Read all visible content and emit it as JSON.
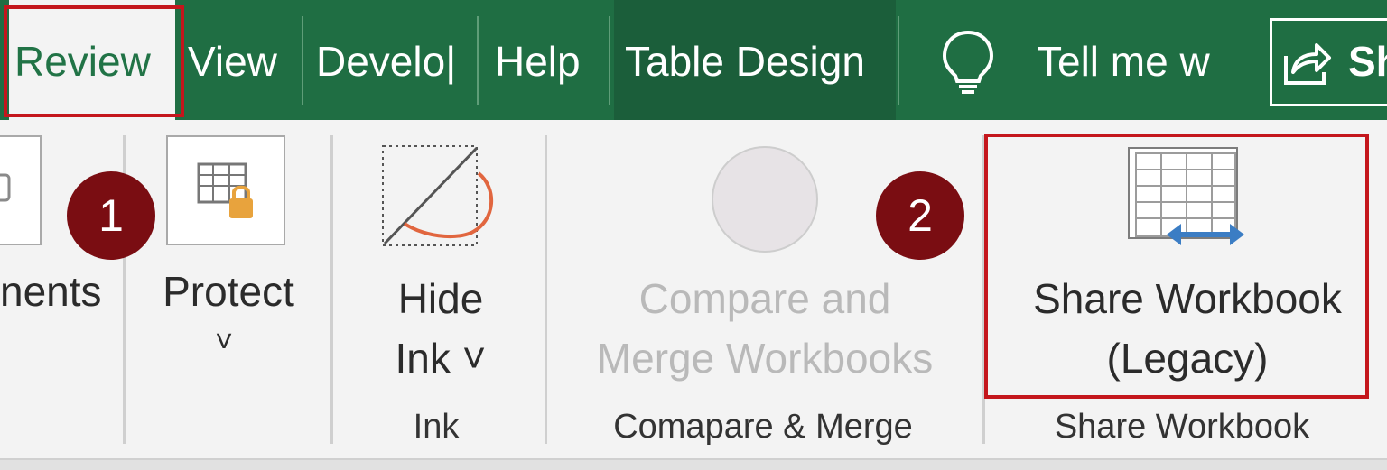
{
  "tabs": {
    "review": "Review",
    "view": "View",
    "developer": "Develo|",
    "help": "Help",
    "table_design": "Table Design"
  },
  "tell_me": "Tell me w",
  "share_label": "Sh",
  "ribbon": {
    "comments_fragment": "nents",
    "protect_label": "Protect",
    "protect_chevron": "˅",
    "hide_ink_line1": "Hide",
    "hide_ink_line2": "Ink ˅",
    "compare_line1": "Compare and",
    "compare_line2": "Merge Workbooks",
    "share_wb_line1": "Share Workbook",
    "share_wb_line2": "(Legacy)"
  },
  "groups": {
    "ink": "Ink",
    "compare_merge": "Comapare & Merge",
    "share_workbook": "Share Workbook"
  },
  "callouts": {
    "one": "1",
    "two": "2"
  },
  "colors": {
    "tab_bar": "#1f6e43",
    "highlight": "#c4161c",
    "callout": "#7a0d12"
  }
}
